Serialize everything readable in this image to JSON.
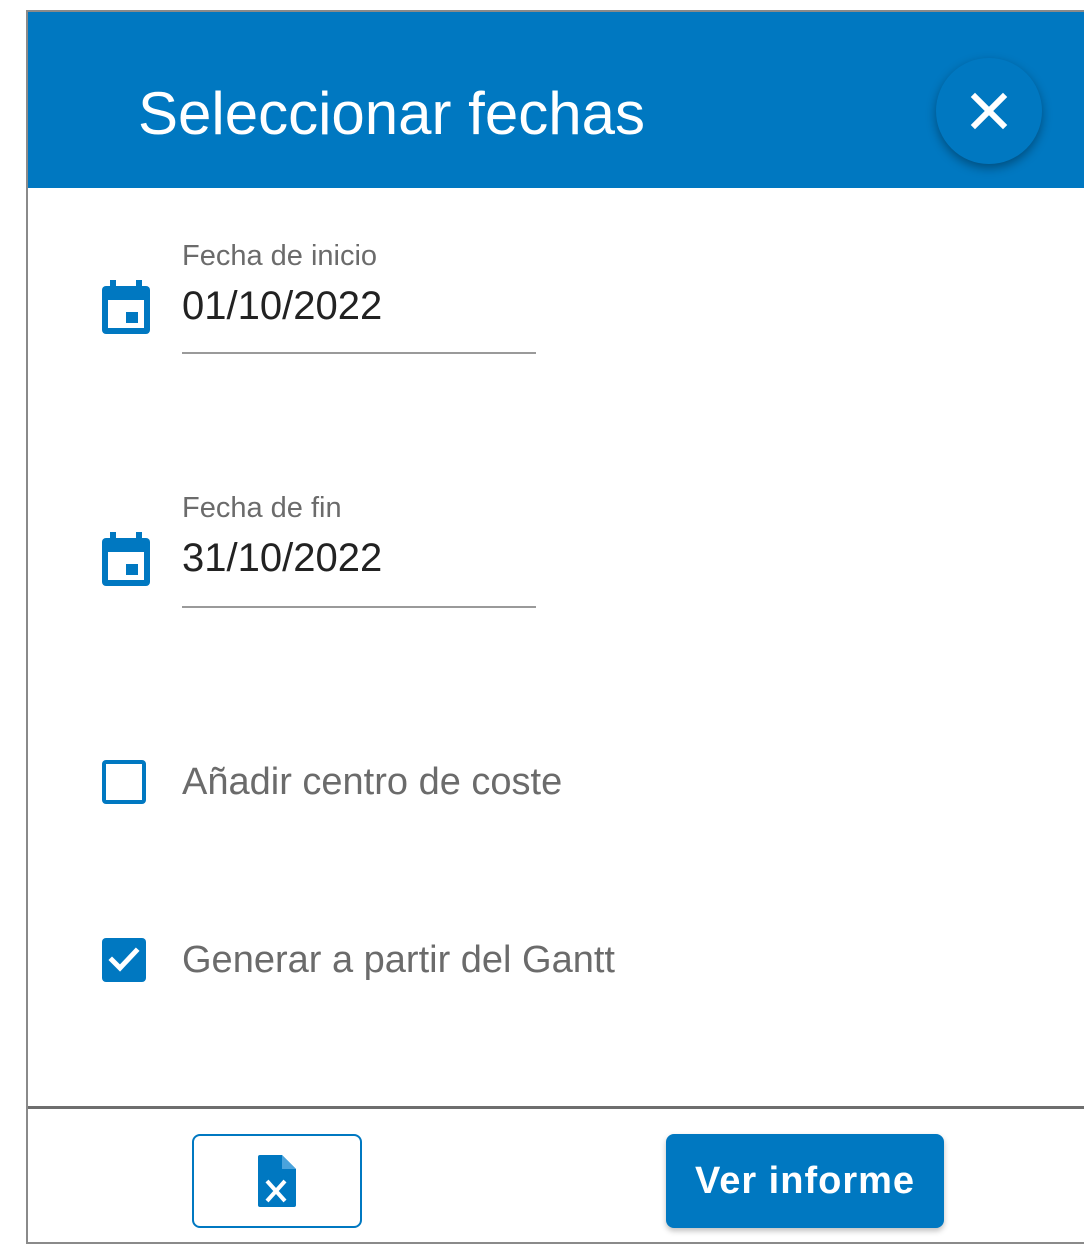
{
  "dialog": {
    "title": "Seleccionar fechas",
    "close_icon": "close-icon"
  },
  "fields": {
    "start": {
      "label": "Fecha de inicio",
      "value": "01/10/2022",
      "icon": "calendar-icon"
    },
    "end": {
      "label": "Fecha de fin",
      "value": "31/10/2022",
      "icon": "calendar-icon"
    }
  },
  "options": {
    "cost_center": {
      "label": "Añadir centro de coste",
      "checked": false
    },
    "gantt": {
      "label": "Generar a partir del Gantt",
      "checked": true
    }
  },
  "footer": {
    "excel_icon": "excel-file-icon",
    "report_label": "Ver informe"
  },
  "colors": {
    "primary": "#0078c1",
    "label_gray": "#6b6b6b",
    "text": "#222222"
  }
}
